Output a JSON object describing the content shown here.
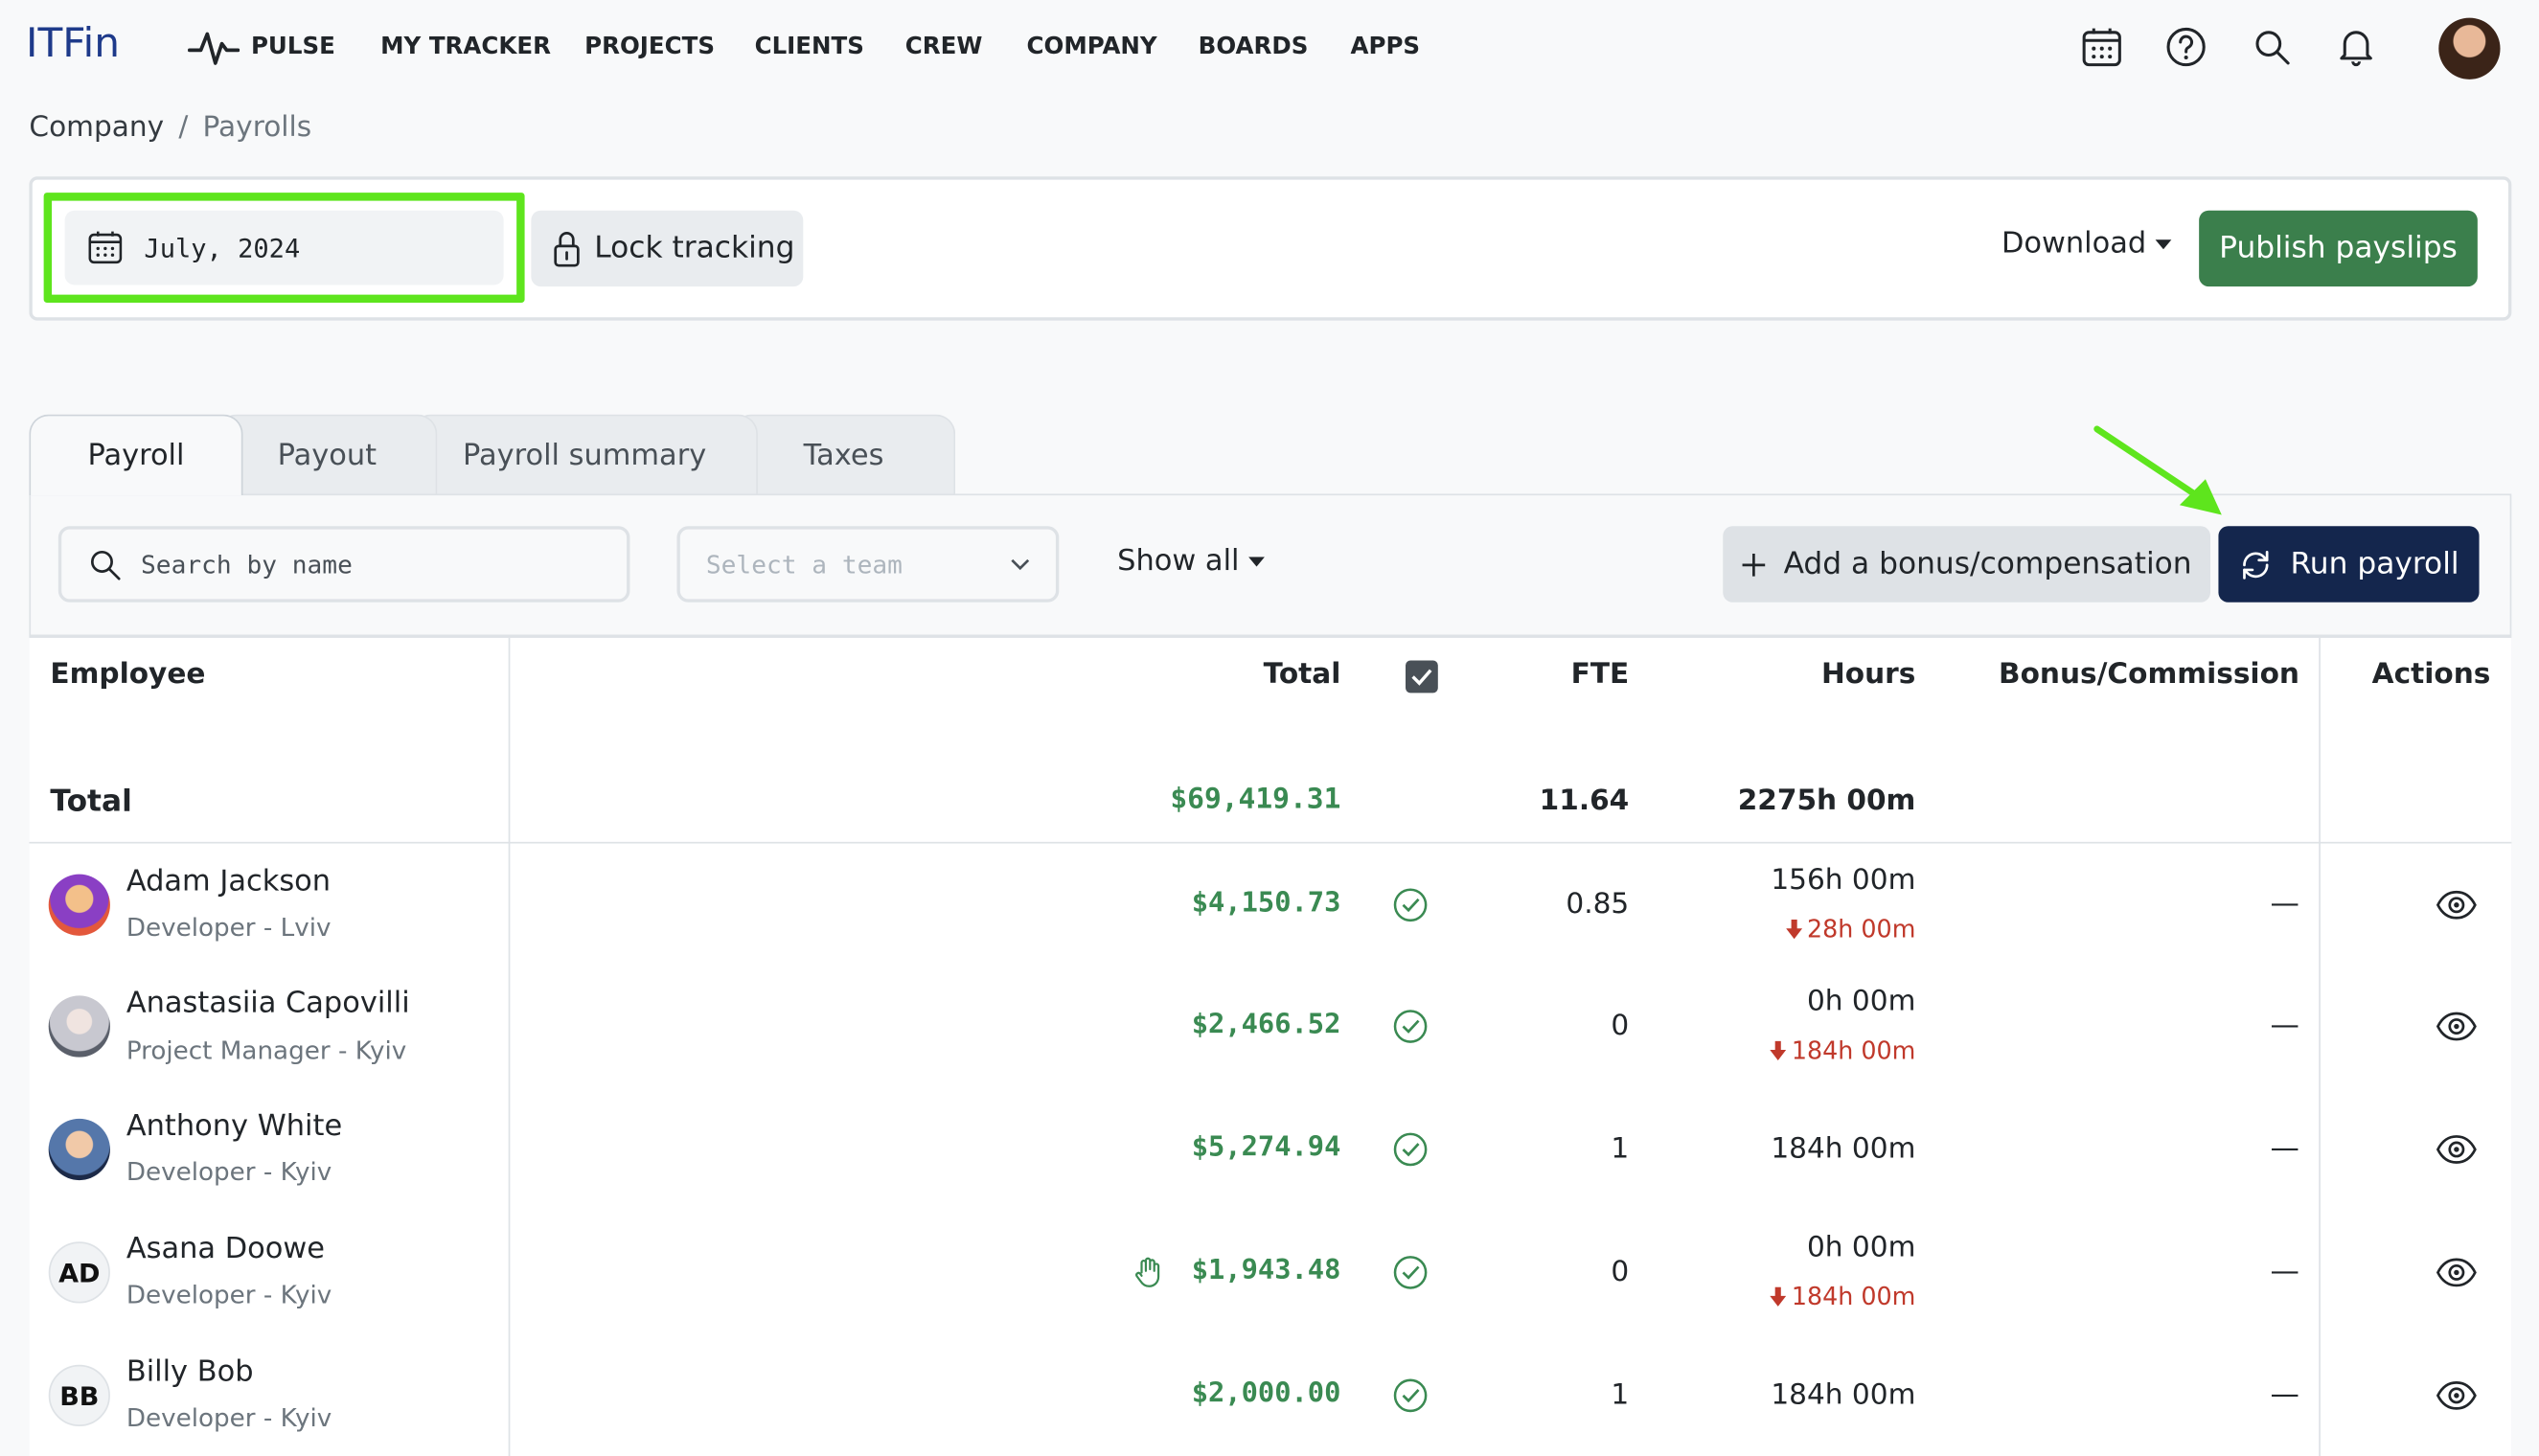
{
  "app": {
    "logo": "ITFin"
  },
  "nav": {
    "items": [
      "PULSE",
      "MY TRACKER",
      "PROJECTS",
      "CLIENTS",
      "CREW",
      "COMPANY",
      "BOARDS",
      "APPS"
    ],
    "icons": [
      "calendar-icon",
      "help-icon",
      "search-icon",
      "bell-icon"
    ]
  },
  "breadcrumb": {
    "parent": "Company",
    "separator": "/",
    "current": "Payrolls"
  },
  "toolbar": {
    "month": "July, 2024",
    "lock_label": "Lock tracking",
    "download_label": "Download",
    "publish_label": "Publish payslips"
  },
  "tabs": [
    "Payroll",
    "Payout",
    "Payroll summary",
    "Taxes"
  ],
  "filters": {
    "search_placeholder": "Search by name",
    "team_placeholder": "Select a team",
    "show_all": "Show all",
    "add_bonus": "Add a bonus/compensation",
    "run_payroll": "Run payroll"
  },
  "table": {
    "headers": {
      "employee": "Employee",
      "total": "Total",
      "fte": "FTE",
      "hours": "Hours",
      "bonus": "Bonus/Commission",
      "actions": "Actions"
    },
    "totals": {
      "label": "Total",
      "total": "$69,419.31",
      "fte": "11.64",
      "hours": "2275h 00m"
    },
    "rows": [
      {
        "name": "Adam Jackson",
        "role": "Developer - Lviv",
        "total": "$4,150.73",
        "fte": "0.85",
        "hours": "156h 00m",
        "deficit": "28h 00m",
        "bonus": "—",
        "initials": ""
      },
      {
        "name": "Anastasiia Capovilli",
        "role": "Project Manager - Kyiv",
        "total": "$2,466.52",
        "fte": "0",
        "hours": "0h 00m",
        "deficit": "184h 00m",
        "bonus": "—",
        "initials": ""
      },
      {
        "name": "Anthony White",
        "role": "Developer - Kyiv",
        "total": "$5,274.94",
        "fte": "1",
        "hours": "184h 00m",
        "deficit": "",
        "bonus": "—",
        "initials": ""
      },
      {
        "name": "Asana Doowe",
        "role": "Developer - Kyiv",
        "total": "$1,943.48",
        "fte": "0",
        "hours": "0h 00m",
        "deficit": "184h 00m",
        "bonus": "—",
        "initials": "AD"
      },
      {
        "name": "Billy Bob",
        "role": "Developer - Kyiv",
        "total": "$2,000.00",
        "fte": "1",
        "hours": "184h 00m",
        "deficit": "",
        "bonus": "—",
        "initials": "BB"
      }
    ]
  },
  "colors": {
    "accent_green": "#3a8a52",
    "publish_bg": "#3b7f4c",
    "run_bg": "#14264d",
    "highlight": "#5ee51d",
    "deficit_red": "#c0392b"
  }
}
